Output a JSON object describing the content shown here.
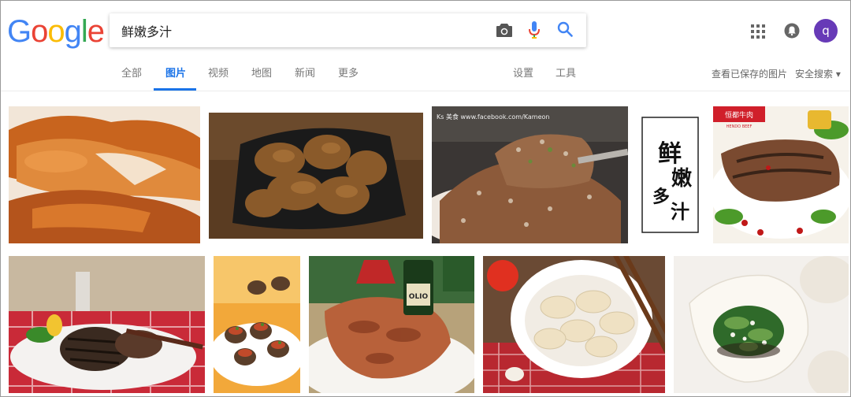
{
  "logo": {
    "text": "Google",
    "letters": [
      {
        "ch": "G",
        "color": "#4285F4"
      },
      {
        "ch": "o",
        "color": "#EA4335"
      },
      {
        "ch": "o",
        "color": "#FBBC05"
      },
      {
        "ch": "g",
        "color": "#4285F4"
      },
      {
        "ch": "l",
        "color": "#34A853"
      },
      {
        "ch": "e",
        "color": "#EA4335"
      }
    ]
  },
  "search": {
    "query": "鲜嫩多汁"
  },
  "icons": {
    "camera": "camera-icon",
    "mic": "mic-icon",
    "search": "search-icon",
    "apps": "apps-grid-icon",
    "notifications": "bell-icon"
  },
  "account": {
    "avatar_letter": "q",
    "avatar_color": "#673ab7"
  },
  "nav": {
    "tabs": [
      {
        "label": "全部",
        "active": false
      },
      {
        "label": "图片",
        "active": true
      },
      {
        "label": "视频",
        "active": false
      },
      {
        "label": "地图",
        "active": false
      },
      {
        "label": "新闻",
        "active": false
      },
      {
        "label": "更多",
        "active": false
      }
    ],
    "settings_label": "设置",
    "tools_label": "工具",
    "saved_images_label": "查看已保存的图片",
    "safesearch_label": "安全搜索 ▾"
  },
  "results": {
    "images": [
      {
        "subject": "roasted-chicken-wings"
      },
      {
        "subject": "fried-chicken-pieces"
      },
      {
        "subject": "crusted-meat-on-spoon",
        "watermark": "Ks 美食 www.facebook.com/Kameon"
      },
      {
        "subject": "calligraphy",
        "calligraphy_text": "鲜嫩多汁"
      },
      {
        "subject": "grilled-steak",
        "brand": "恒都牛肉",
        "brand_sub": "HENDO BEEF"
      },
      {
        "subject": "steak-on-plate"
      },
      {
        "subject": "stuffed-mushrooms"
      },
      {
        "subject": "grilled-pork-chop",
        "label": "OLIO"
      },
      {
        "subject": "dumplings-plate"
      },
      {
        "subject": "spinach-dumpling"
      }
    ]
  },
  "colors": {
    "accent": "#1a73e8",
    "tab_text": "#777777"
  }
}
